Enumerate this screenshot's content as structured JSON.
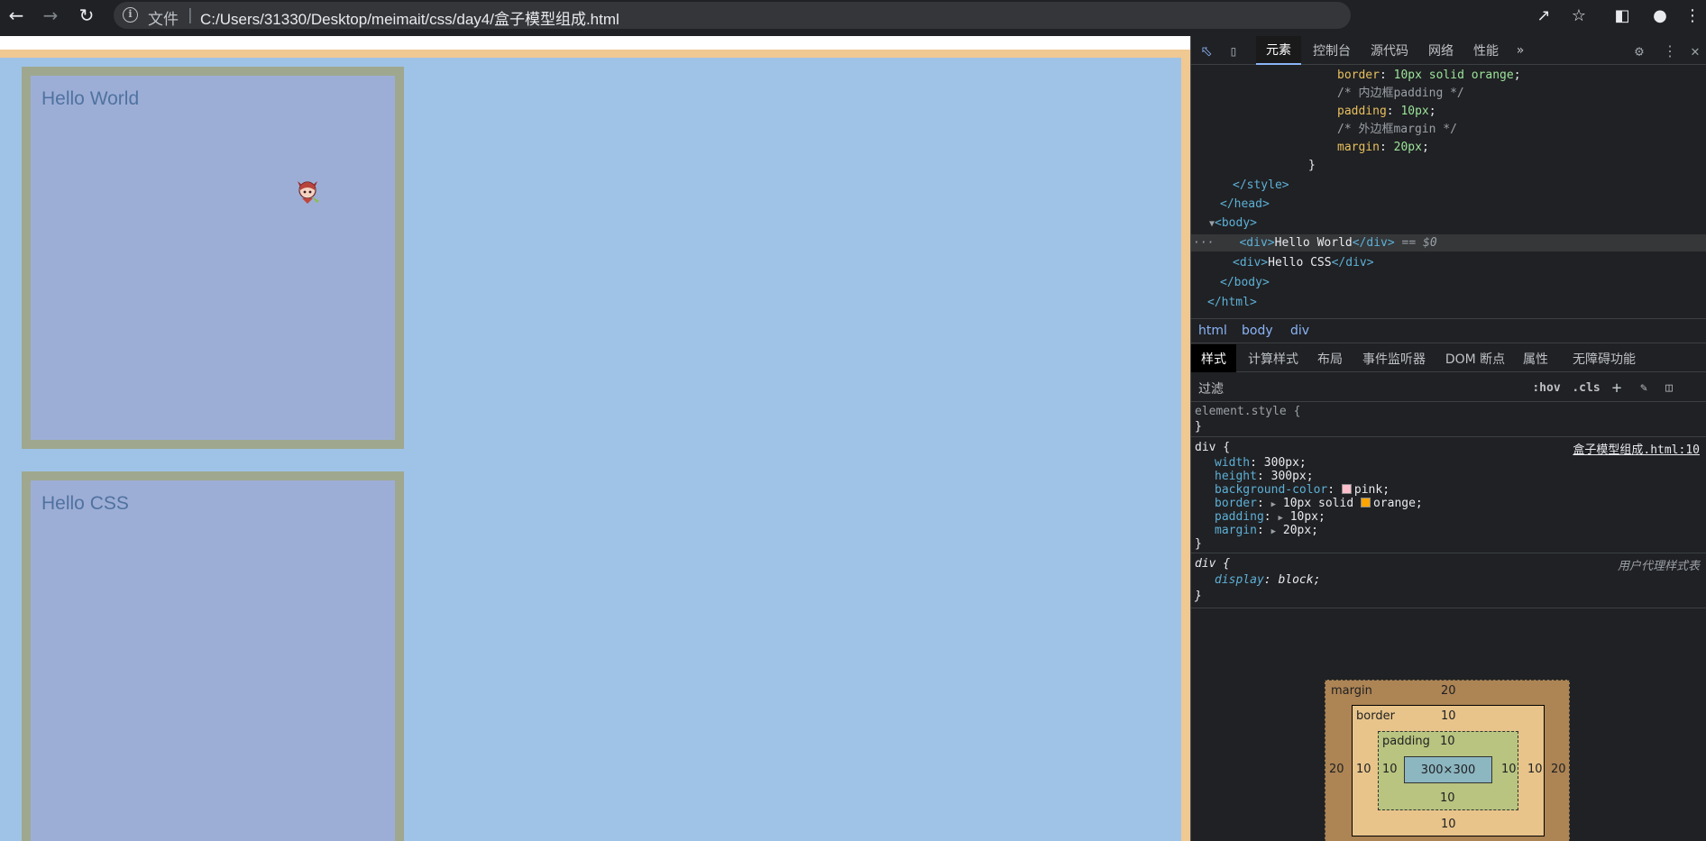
{
  "browser": {
    "scheme_label": "文件",
    "url": "C:/Users/31330/Desktop/meimait/css/day4/盒子模型组成.html"
  },
  "page": {
    "box1_text": "Hello World",
    "box2_text": "Hello CSS",
    "colors": {
      "html_bg": "#f0c892",
      "body_bg": "#9fc3e7",
      "box_bg": "#9daed6",
      "box_border": "#9fa88e"
    }
  },
  "devtools": {
    "tabs": [
      "元素",
      "控制台",
      "源代码",
      "网络",
      "性能"
    ],
    "more": "»",
    "elements": {
      "l1_prop": "border",
      "l1_val": "10px solid orange",
      "l2": "/* 内边框padding */",
      "l3_prop": "padding",
      "l3_val": "10px",
      "l4": "/* 外边框margin */",
      "l5_prop": "margin",
      "l5_val": "20px",
      "l6": "}",
      "l7": "</style>",
      "l8": "</head>",
      "l9": "<body>",
      "l10_open": "<div>",
      "l10_text": "Hello World",
      "l10_close": "</div>",
      "l10_suffix": " == $0",
      "l11_open": "<div>",
      "l11_text": "Hello CSS",
      "l11_close": "</div>",
      "l12": "</body>",
      "l13": "</html>",
      "ellipsis": "···"
    },
    "breadcrumb": [
      "html",
      "body",
      "div"
    ],
    "styles_tabs": [
      "样式",
      "计算样式",
      "布局",
      "事件监听器",
      "DOM 断点",
      "属性",
      "无障碍功能"
    ],
    "filter": {
      "label": "过滤",
      "hov": ":hov",
      "cls": ".cls",
      "plus": "+"
    },
    "rules": {
      "element_style": "element.style {",
      "close": "}",
      "div_selector": "div {",
      "div_source": "盒子模型组成.html:10",
      "decls": [
        {
          "prop": "width",
          "val": "300px;"
        },
        {
          "prop": "height",
          "val": "300px;"
        },
        {
          "prop": "background-color",
          "val": "pink;"
        },
        {
          "prop": "border",
          "val": "10px solid orange;"
        },
        {
          "prop": "padding",
          "val": "10px;"
        },
        {
          "prop": "margin",
          "val": "20px;"
        }
      ],
      "ua_selector": "div {",
      "ua_source": "用户代理样式表",
      "ua_prop": "display",
      "ua_val": "block;"
    },
    "swatch_colors": {
      "pink": "#ffc0cb",
      "orange": "#ffa500"
    },
    "box_model": {
      "margin_label": "margin",
      "margin": "20",
      "border_label": "border",
      "border": "10",
      "padding_label": "padding",
      "padding": "10",
      "content": "300×300",
      "margin_left": "20",
      "margin_right": "20",
      "border_left": "10",
      "border_right": "10",
      "padding_left": "10",
      "padding_right": "10",
      "padding_bottom": "10",
      "border_bottom": "10"
    }
  }
}
